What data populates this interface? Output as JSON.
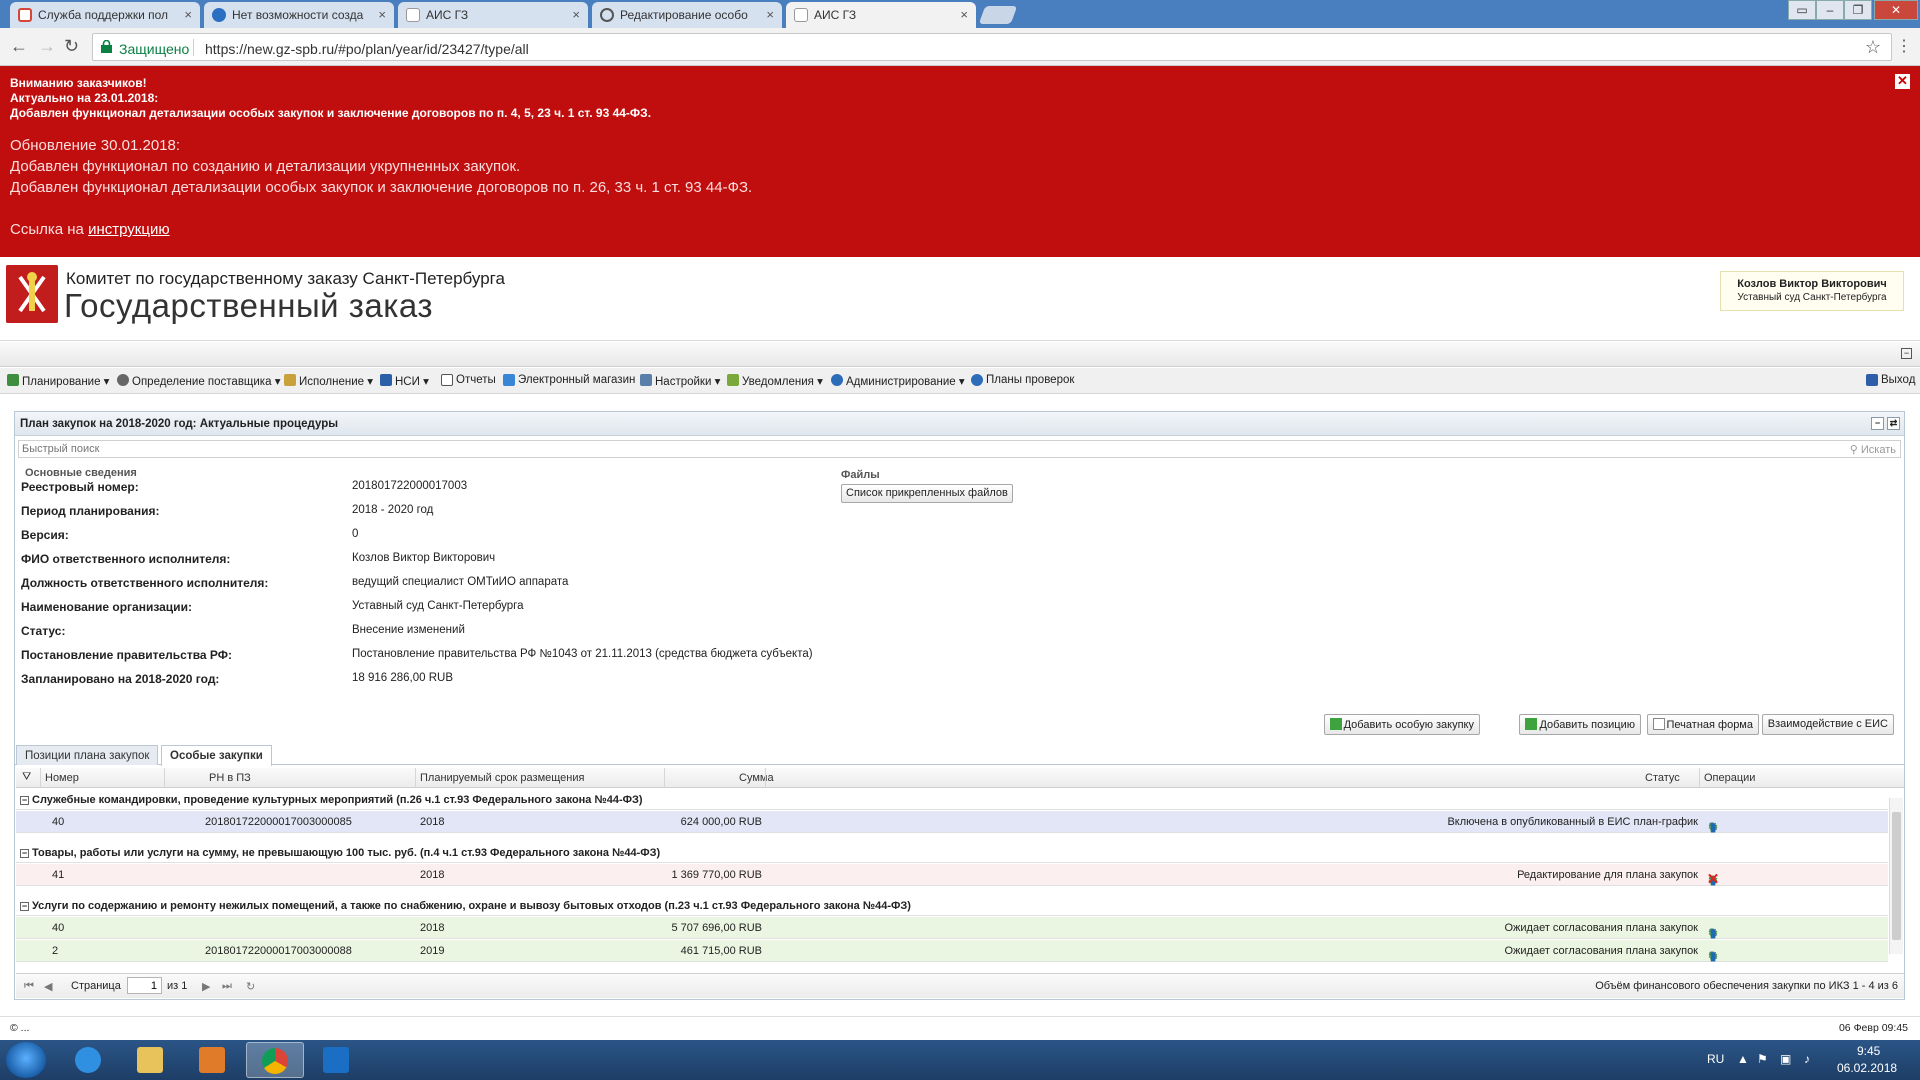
{
  "browser": {
    "tabs": [
      {
        "label": "Служба поддержки пол",
        "color": "#d44638"
      },
      {
        "label": "Нет возможности созда",
        "color": "#2b6fc2"
      },
      {
        "label": "АИС ГЗ",
        "color": "#cfd7e2"
      },
      {
        "label": "Редактирование особо",
        "color": "#555555"
      },
      {
        "label": "АИС ГЗ",
        "color": "#cfd7e2"
      }
    ],
    "secure_label": "Защищено",
    "url": "https://new.gz-spb.ru/#po/plan/year/id/23427/type/all"
  },
  "banner": {
    "line1": "Вниманию заказчиков!",
    "line2": "Актуально на 23.01.2018:",
    "line3": "Добавлен функционал детализации особых закупок и заключение договоров по п. 4, 5, 23 ч. 1 ст. 93 44-ФЗ.",
    "line4": "Обновление 30.01.2018:",
    "line5": "Добавлен функционал по созданию и детализации укрупненных закупок.",
    "line6": "Добавлен функционал детализации особых закупок и заключение договоров по п. 26, 33 ч. 1 ст. 93 44-ФЗ.",
    "link_prefix": "Ссылка на",
    "link_text": "инструкцию",
    "bg_color": "#c00d0d"
  },
  "header": {
    "org": "Комитет по государственному заказу Санкт-Петербурга",
    "title": "Государственный заказ",
    "user_name": "Козлов Виктор Викторович",
    "user_org": "Уставный суд Санкт-Петербурга"
  },
  "menu": {
    "items": [
      {
        "label": "Планирование",
        "icon": "plan-icon"
      },
      {
        "label": "Определение поставщика",
        "icon": "supplier-icon"
      },
      {
        "label": "Исполнение",
        "icon": "execution-icon"
      },
      {
        "label": "НСИ",
        "icon": "nsi-icon"
      },
      {
        "label": "Отчеты",
        "icon": "reports-icon"
      },
      {
        "label": "Электронный магазин",
        "icon": "shop-icon"
      },
      {
        "label": "Настройки",
        "icon": "settings-icon"
      },
      {
        "label": "Уведомления",
        "icon": "notify-icon"
      },
      {
        "label": "Администрирование",
        "icon": "admin-icon"
      },
      {
        "label": "Планы проверок",
        "icon": "checks-icon"
      }
    ],
    "exit": "Выход"
  },
  "panel": {
    "title": "План закупок на 2018-2020 год: Актуальные процедуры",
    "search_placeholder": "Быстрый поиск",
    "search_button": "Искать",
    "section_title": "Основные сведения",
    "files_title": "Файлы",
    "files_button": "Список прикрепленных файлов",
    "fields": [
      {
        "label": "Реестровый номер:",
        "value": "201801722000017003"
      },
      {
        "label": "Период планирования:",
        "value": "2018 - 2020 год"
      },
      {
        "label": "Версия:",
        "value": "0"
      },
      {
        "label": "ФИО ответственного исполнителя:",
        "value": "Козлов Виктор Викторович"
      },
      {
        "label": "Должность ответственного исполнителя:",
        "value": "ведущий специалист ОМТиИО аппарата"
      },
      {
        "label": "Наименование организации:",
        "value": "Уставный суд Санкт-Петербурга"
      },
      {
        "label": "Статус:",
        "value": "Внесение изменений"
      },
      {
        "label": "Постановление правительства РФ:",
        "value": "Постановление правительства РФ №1043 от 21.11.2013 (средства бюджета субъекта)"
      },
      {
        "label": "Запланировано на 2018-2020 год:",
        "value": "18 916 286,00 RUB"
      }
    ],
    "actions": [
      "Добавить особую закупку",
      "Добавить позицию",
      "Печатная форма",
      "Взаимодействие с ЕИС"
    ],
    "tabs": [
      "Позиции плана закупок",
      "Особые закупки"
    ]
  },
  "grid": {
    "columns": [
      "Номер",
      "РН в ПЗ",
      "Планируемый срок размещения",
      "Сумма",
      "Статус",
      "Операции"
    ],
    "groups": [
      {
        "title": "Служебные командировки, проведение культурных мероприятий (п.26 ч.1 ст.93 Федерального закона №44-ФЗ)"
      },
      {
        "title": "Товары, работы или услуги на сумму, не превышающую 100 тыс. руб. (п.4 ч.1 ст.93 Федерального закона №44-ФЗ)"
      },
      {
        "title": "Услуги по содержанию и ремонту нежилых помещений, а также по снабжению, охране и вывозу бытовых отходов (п.23 ч.1 ст.93 Федерального закона №44-ФЗ)"
      }
    ],
    "rows": [
      {
        "num": "40",
        "rn": "201801722000017003000085",
        "year": "2018",
        "sum": "624 000,00 RUB",
        "status": "Включена в опубликованный в ЕИС план-график"
      },
      {
        "num": "41",
        "rn": "",
        "year": "2018",
        "sum": "1 369 770,00 RUB",
        "status": "Редактирование для плана закупок"
      },
      {
        "num": "40",
        "rn": "",
        "year": "2018",
        "sum": "5 707 696,00 RUB",
        "status": "Ожидает согласования плана закупок"
      },
      {
        "num": "2",
        "rn": "201801722000017003000088",
        "year": "2019",
        "sum": "461 715,00 RUB",
        "status": "Ожидает согласования плана закупок"
      }
    ]
  },
  "pager": {
    "page_label": "Страница",
    "page_value": "1",
    "of_label": "из 1",
    "summary": "Объём финансового обеспечения закупки по ИКЗ 1 - 4 из 6"
  },
  "statusbar": {
    "left": "© ...",
    "right": "06 Февр 09:45"
  },
  "taskbar": {
    "lang": "RU",
    "time": "9:45",
    "date": "06.02.2018"
  }
}
